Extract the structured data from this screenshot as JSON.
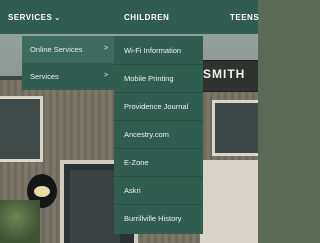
{
  "nav": {
    "services_label": "SERVICES",
    "children_label": "CHILDREN",
    "teens_label": "TEENS"
  },
  "menu_level1": {
    "items": [
      {
        "label": "Online Services",
        "arrow": ">"
      },
      {
        "label": "Services",
        "arrow": ">"
      }
    ]
  },
  "menu_level2": {
    "items": [
      {
        "label": "Wi-Fi Information"
      },
      {
        "label": "Mobile Printing"
      },
      {
        "label": "Providence Journal"
      },
      {
        "label": "Ancestry.com"
      },
      {
        "label": "E-Zone"
      },
      {
        "label": "Askri"
      },
      {
        "label": "Burrillville History"
      }
    ]
  },
  "background": {
    "sign_text": "SMITH"
  },
  "colors": {
    "nav_bg": "#2f5d50",
    "menu_bg": "#2f5d50",
    "active_item_bg": "#3d6b5e",
    "text": "#ffffff"
  }
}
